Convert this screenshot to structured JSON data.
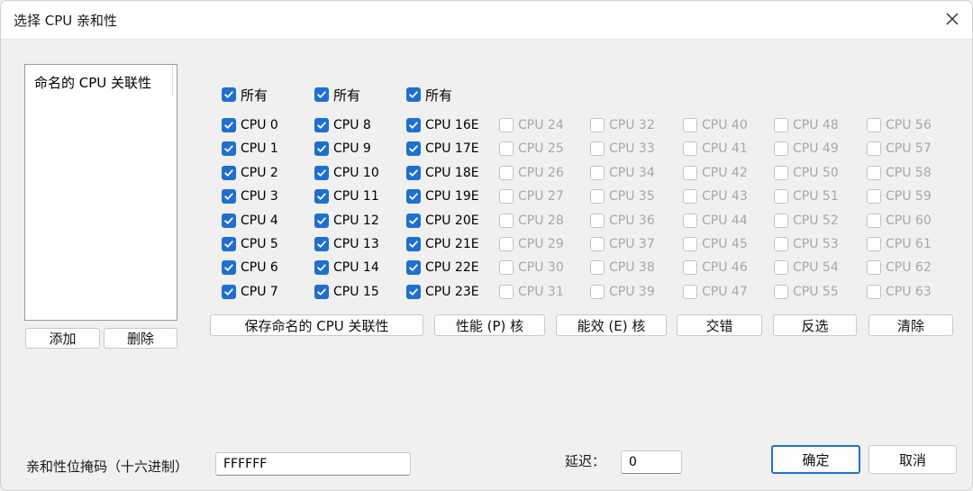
{
  "window": {
    "title": "选择 CPU 亲和性"
  },
  "named_list": {
    "header": "命名的 CPU 关联性"
  },
  "left_buttons": {
    "add": "添加",
    "delete": "删除"
  },
  "select_all": [
    {
      "label": "所有",
      "checked": true
    },
    {
      "label": "所有",
      "checked": true
    },
    {
      "label": "所有",
      "checked": true
    }
  ],
  "cpu_columns": [
    [
      {
        "label": "CPU 0",
        "checked": true,
        "enabled": true
      },
      {
        "label": "CPU 1",
        "checked": true,
        "enabled": true
      },
      {
        "label": "CPU 2",
        "checked": true,
        "enabled": true
      },
      {
        "label": "CPU 3",
        "checked": true,
        "enabled": true
      },
      {
        "label": "CPU 4",
        "checked": true,
        "enabled": true
      },
      {
        "label": "CPU 5",
        "checked": true,
        "enabled": true
      },
      {
        "label": "CPU 6",
        "checked": true,
        "enabled": true
      },
      {
        "label": "CPU 7",
        "checked": true,
        "enabled": true
      }
    ],
    [
      {
        "label": "CPU 8",
        "checked": true,
        "enabled": true
      },
      {
        "label": "CPU 9",
        "checked": true,
        "enabled": true
      },
      {
        "label": "CPU 10",
        "checked": true,
        "enabled": true
      },
      {
        "label": "CPU 11",
        "checked": true,
        "enabled": true
      },
      {
        "label": "CPU 12",
        "checked": true,
        "enabled": true
      },
      {
        "label": "CPU 13",
        "checked": true,
        "enabled": true
      },
      {
        "label": "CPU 14",
        "checked": true,
        "enabled": true
      },
      {
        "label": "CPU 15",
        "checked": true,
        "enabled": true
      }
    ],
    [
      {
        "label": "CPU 16E",
        "checked": true,
        "enabled": true
      },
      {
        "label": "CPU 17E",
        "checked": true,
        "enabled": true
      },
      {
        "label": "CPU 18E",
        "checked": true,
        "enabled": true
      },
      {
        "label": "CPU 19E",
        "checked": true,
        "enabled": true
      },
      {
        "label": "CPU 20E",
        "checked": true,
        "enabled": true
      },
      {
        "label": "CPU 21E",
        "checked": true,
        "enabled": true
      },
      {
        "label": "CPU 22E",
        "checked": true,
        "enabled": true
      },
      {
        "label": "CPU 23E",
        "checked": true,
        "enabled": true
      }
    ],
    [
      {
        "label": "CPU 24",
        "checked": false,
        "enabled": false
      },
      {
        "label": "CPU 25",
        "checked": false,
        "enabled": false
      },
      {
        "label": "CPU 26",
        "checked": false,
        "enabled": false
      },
      {
        "label": "CPU 27",
        "checked": false,
        "enabled": false
      },
      {
        "label": "CPU 28",
        "checked": false,
        "enabled": false
      },
      {
        "label": "CPU 29",
        "checked": false,
        "enabled": false
      },
      {
        "label": "CPU 30",
        "checked": false,
        "enabled": false
      },
      {
        "label": "CPU 31",
        "checked": false,
        "enabled": false
      }
    ],
    [
      {
        "label": "CPU 32",
        "checked": false,
        "enabled": false
      },
      {
        "label": "CPU 33",
        "checked": false,
        "enabled": false
      },
      {
        "label": "CPU 34",
        "checked": false,
        "enabled": false
      },
      {
        "label": "CPU 35",
        "checked": false,
        "enabled": false
      },
      {
        "label": "CPU 36",
        "checked": false,
        "enabled": false
      },
      {
        "label": "CPU 37",
        "checked": false,
        "enabled": false
      },
      {
        "label": "CPU 38",
        "checked": false,
        "enabled": false
      },
      {
        "label": "CPU 39",
        "checked": false,
        "enabled": false
      }
    ],
    [
      {
        "label": "CPU 40",
        "checked": false,
        "enabled": false
      },
      {
        "label": "CPU 41",
        "checked": false,
        "enabled": false
      },
      {
        "label": "CPU 42",
        "checked": false,
        "enabled": false
      },
      {
        "label": "CPU 43",
        "checked": false,
        "enabled": false
      },
      {
        "label": "CPU 44",
        "checked": false,
        "enabled": false
      },
      {
        "label": "CPU 45",
        "checked": false,
        "enabled": false
      },
      {
        "label": "CPU 46",
        "checked": false,
        "enabled": false
      },
      {
        "label": "CPU 47",
        "checked": false,
        "enabled": false
      }
    ],
    [
      {
        "label": "CPU 48",
        "checked": false,
        "enabled": false
      },
      {
        "label": "CPU 49",
        "checked": false,
        "enabled": false
      },
      {
        "label": "CPU 50",
        "checked": false,
        "enabled": false
      },
      {
        "label": "CPU 51",
        "checked": false,
        "enabled": false
      },
      {
        "label": "CPU 52",
        "checked": false,
        "enabled": false
      },
      {
        "label": "CPU 53",
        "checked": false,
        "enabled": false
      },
      {
        "label": "CPU 54",
        "checked": false,
        "enabled": false
      },
      {
        "label": "CPU 55",
        "checked": false,
        "enabled": false
      }
    ],
    [
      {
        "label": "CPU 56",
        "checked": false,
        "enabled": false
      },
      {
        "label": "CPU 57",
        "checked": false,
        "enabled": false
      },
      {
        "label": "CPU 58",
        "checked": false,
        "enabled": false
      },
      {
        "label": "CPU 59",
        "checked": false,
        "enabled": false
      },
      {
        "label": "CPU 60",
        "checked": false,
        "enabled": false
      },
      {
        "label": "CPU 61",
        "checked": false,
        "enabled": false
      },
      {
        "label": "CPU 62",
        "checked": false,
        "enabled": false
      },
      {
        "label": "CPU 63",
        "checked": false,
        "enabled": false
      }
    ]
  ],
  "actions": {
    "save_named": "保存命名的 CPU 关联性",
    "performance_cores": "性能 (P) 核",
    "efficiency_cores": "能效 (E) 核",
    "interleave": "交错",
    "invert": "反选",
    "clear": "清除"
  },
  "mask": {
    "label": "亲和性位掩码（十六进制）",
    "value": "FFFFFF"
  },
  "delay": {
    "label": "延迟：",
    "value": "0"
  },
  "dialog_buttons": {
    "ok": "确定",
    "cancel": "取消"
  },
  "colors": {
    "accent": "#1f6fd1",
    "disabled_text": "#a8a8a8",
    "primary_border": "#1f72c7"
  }
}
